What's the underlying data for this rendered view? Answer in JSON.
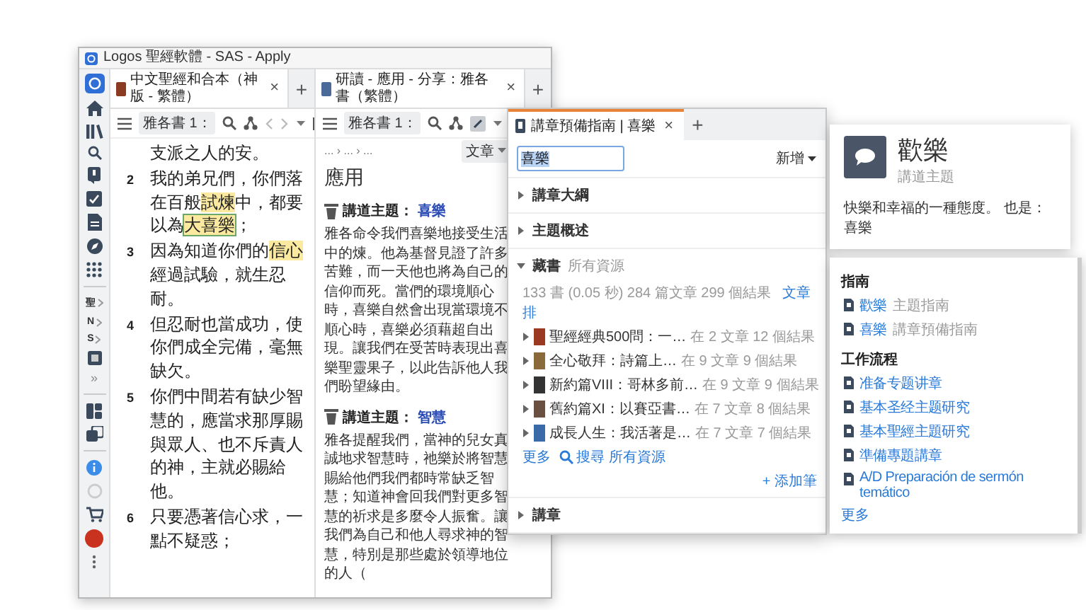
{
  "main_window": {
    "title": "Logos 聖經軟體 - SAS - Apply",
    "sidebar": {
      "shortcuts": [
        {
          "label": "聖"
        },
        {
          "label": "N"
        },
        {
          "label": "S"
        }
      ],
      "more": "»"
    },
    "bible_pane": {
      "tab": {
        "title": "中文聖經和合本（神版 - 繁體）",
        "close": "×"
      },
      "new_tab": "+",
      "reference": "雅各書 1：",
      "verses": [
        {
          "segments": [
            {
              "text": "支派之人的安。",
              "highlighted": false,
              "boxed": false
            }
          ]
        },
        {
          "number": "2",
          "segments": [
            {
              "text": "我的弟兄們，你們落在百般",
              "highlighted": false,
              "boxed": false
            },
            {
              "text": "試煉",
              "highlighted": true,
              "boxed": false
            },
            {
              "text": "中，都要以為",
              "highlighted": false,
              "boxed": false
            },
            {
              "text": "大喜樂",
              "highlighted": true,
              "boxed": true
            },
            {
              "text": "；",
              "highlighted": false,
              "boxed": false
            }
          ]
        },
        {
          "number": "3",
          "segments": [
            {
              "text": "因為知道你們的",
              "highlighted": false,
              "boxed": false
            },
            {
              "text": "信心",
              "highlighted": true,
              "boxed": false
            },
            {
              "text": "經過試驗，就生忍耐。",
              "highlighted": false,
              "boxed": false
            }
          ]
        },
        {
          "number": "4",
          "segments": [
            {
              "text": "但忍耐也當成功，使你們成全完備，毫無缺欠。",
              "highlighted": false,
              "boxed": false
            }
          ]
        },
        {
          "number": "5",
          "segments": [
            {
              "text": "你們中間若有缺少智慧的，應當求那厚賜與眾人、也不斥責人的神，主就必賜給他。",
              "highlighted": false,
              "boxed": false
            }
          ]
        },
        {
          "number": "6",
          "segments": [
            {
              "text": "只要憑著信心求，一點不疑惑；",
              "highlighted": false,
              "boxed": false
            }
          ]
        }
      ]
    },
    "study_pane": {
      "tab": {
        "title": "研讀 - 應用 - 分享：雅各書（繁體）",
        "close": "×"
      },
      "new_tab": "+",
      "reference": "雅各書 1：",
      "breadcrumb": "... › ... › ...",
      "view_button": "文章",
      "heading": "應用",
      "sections": [
        {
          "label": "講道主題：",
          "topic": "喜樂",
          "text": "雅各命令我們喜樂地接受生活中的煉。他為基督見證了許多苦難，而一天他也將為自己的信仰而死。當們的環境順心時，喜樂自然會出現當環境不順心時，喜樂必須藉超自出現。讓我們在受苦時表現出喜樂聖靈果子，以此告訴他人我們盼望緣由。"
        },
        {
          "label": "講道主題：",
          "topic": "智慧",
          "text": "雅各提醒我們，當神的兒女真誠地求智慧時，祂樂於將智慧賜給他們我們都時常缺乏智慧；知道神會回我們對更多智慧的祈求是多麼令人振奮。讓我們為自己和他人尋求神的智慧，特別是那些處於領導地位的人（"
        }
      ]
    }
  },
  "guide_popup": {
    "tab": {
      "title": "講章預備指南 | 喜樂",
      "close": "×"
    },
    "new_tab": "+",
    "search": {
      "value": "喜樂"
    },
    "add_button": "新增",
    "sections": [
      {
        "title": "講章大綱",
        "expanded": false
      },
      {
        "title": "主題概述",
        "expanded": false
      },
      {
        "title": "藏書",
        "subtitle": "所有資源",
        "expanded": true,
        "stats": "133 書 (0.05 秒) 284 篇文章 299 個結果",
        "view_link": "文章",
        "rank_link": "排",
        "results": [
          {
            "title": "聖經經典500問：一…",
            "hits": "在 2 文章 12 個結果"
          },
          {
            "title": "全心敬拜：詩篇上…",
            "hits": "在 9 文章 9 個結果"
          },
          {
            "title": "新約篇VIII：哥林多前…",
            "hits": "在 9 文章 9 個結果"
          },
          {
            "title": "舊約篇XI：以賽亞書…",
            "hits": "在 7 文章 8 個結果"
          },
          {
            "title": "成長人生：我活著是…",
            "hits": "在 7 文章 7 個結果"
          }
        ],
        "more_link": "更多",
        "search_all": "搜尋 所有資源",
        "add_note": "+ 添加筆"
      },
      {
        "title": "講章",
        "expanded": false
      }
    ]
  },
  "topic_card": {
    "title": "歡樂",
    "subtitle": "講道主題",
    "description": "快樂和幸福的一種態度。 也是：喜樂"
  },
  "links_card": {
    "groups": [
      {
        "heading": "指南",
        "items": [
          {
            "link": "歡樂",
            "note": "主題指南"
          },
          {
            "link": "喜樂",
            "note": "講章預備指南"
          }
        ]
      },
      {
        "heading": "工作流程",
        "items": [
          {
            "link": "准备专题讲章"
          },
          {
            "link": "基本圣经主题研究"
          },
          {
            "link": "基本聖經主題研究"
          },
          {
            "link": "準備專題講章"
          },
          {
            "link": "A/D Preparación de sermón temático"
          }
        ]
      }
    ],
    "more_link": "更多"
  }
}
